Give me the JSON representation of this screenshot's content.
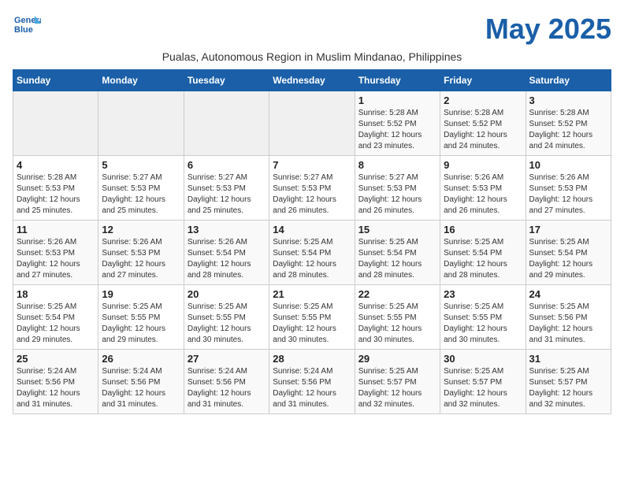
{
  "header": {
    "logo_line1": "General",
    "logo_line2": "Blue",
    "month_title": "May 2025",
    "subtitle": "Pualas, Autonomous Region in Muslim Mindanao, Philippines"
  },
  "weekdays": [
    "Sunday",
    "Monday",
    "Tuesday",
    "Wednesday",
    "Thursday",
    "Friday",
    "Saturday"
  ],
  "weeks": [
    [
      {
        "day": "",
        "info": ""
      },
      {
        "day": "",
        "info": ""
      },
      {
        "day": "",
        "info": ""
      },
      {
        "day": "",
        "info": ""
      },
      {
        "day": "1",
        "info": "Sunrise: 5:28 AM\nSunset: 5:52 PM\nDaylight: 12 hours\nand 23 minutes."
      },
      {
        "day": "2",
        "info": "Sunrise: 5:28 AM\nSunset: 5:52 PM\nDaylight: 12 hours\nand 24 minutes."
      },
      {
        "day": "3",
        "info": "Sunrise: 5:28 AM\nSunset: 5:52 PM\nDaylight: 12 hours\nand 24 minutes."
      }
    ],
    [
      {
        "day": "4",
        "info": "Sunrise: 5:28 AM\nSunset: 5:53 PM\nDaylight: 12 hours\nand 25 minutes."
      },
      {
        "day": "5",
        "info": "Sunrise: 5:27 AM\nSunset: 5:53 PM\nDaylight: 12 hours\nand 25 minutes."
      },
      {
        "day": "6",
        "info": "Sunrise: 5:27 AM\nSunset: 5:53 PM\nDaylight: 12 hours\nand 25 minutes."
      },
      {
        "day": "7",
        "info": "Sunrise: 5:27 AM\nSunset: 5:53 PM\nDaylight: 12 hours\nand 26 minutes."
      },
      {
        "day": "8",
        "info": "Sunrise: 5:27 AM\nSunset: 5:53 PM\nDaylight: 12 hours\nand 26 minutes."
      },
      {
        "day": "9",
        "info": "Sunrise: 5:26 AM\nSunset: 5:53 PM\nDaylight: 12 hours\nand 26 minutes."
      },
      {
        "day": "10",
        "info": "Sunrise: 5:26 AM\nSunset: 5:53 PM\nDaylight: 12 hours\nand 27 minutes."
      }
    ],
    [
      {
        "day": "11",
        "info": "Sunrise: 5:26 AM\nSunset: 5:53 PM\nDaylight: 12 hours\nand 27 minutes."
      },
      {
        "day": "12",
        "info": "Sunrise: 5:26 AM\nSunset: 5:53 PM\nDaylight: 12 hours\nand 27 minutes."
      },
      {
        "day": "13",
        "info": "Sunrise: 5:26 AM\nSunset: 5:54 PM\nDaylight: 12 hours\nand 28 minutes."
      },
      {
        "day": "14",
        "info": "Sunrise: 5:25 AM\nSunset: 5:54 PM\nDaylight: 12 hours\nand 28 minutes."
      },
      {
        "day": "15",
        "info": "Sunrise: 5:25 AM\nSunset: 5:54 PM\nDaylight: 12 hours\nand 28 minutes."
      },
      {
        "day": "16",
        "info": "Sunrise: 5:25 AM\nSunset: 5:54 PM\nDaylight: 12 hours\nand 28 minutes."
      },
      {
        "day": "17",
        "info": "Sunrise: 5:25 AM\nSunset: 5:54 PM\nDaylight: 12 hours\nand 29 minutes."
      }
    ],
    [
      {
        "day": "18",
        "info": "Sunrise: 5:25 AM\nSunset: 5:54 PM\nDaylight: 12 hours\nand 29 minutes."
      },
      {
        "day": "19",
        "info": "Sunrise: 5:25 AM\nSunset: 5:55 PM\nDaylight: 12 hours\nand 29 minutes."
      },
      {
        "day": "20",
        "info": "Sunrise: 5:25 AM\nSunset: 5:55 PM\nDaylight: 12 hours\nand 30 minutes."
      },
      {
        "day": "21",
        "info": "Sunrise: 5:25 AM\nSunset: 5:55 PM\nDaylight: 12 hours\nand 30 minutes."
      },
      {
        "day": "22",
        "info": "Sunrise: 5:25 AM\nSunset: 5:55 PM\nDaylight: 12 hours\nand 30 minutes."
      },
      {
        "day": "23",
        "info": "Sunrise: 5:25 AM\nSunset: 5:55 PM\nDaylight: 12 hours\nand 30 minutes."
      },
      {
        "day": "24",
        "info": "Sunrise: 5:25 AM\nSunset: 5:56 PM\nDaylight: 12 hours\nand 31 minutes."
      }
    ],
    [
      {
        "day": "25",
        "info": "Sunrise: 5:24 AM\nSunset: 5:56 PM\nDaylight: 12 hours\nand 31 minutes."
      },
      {
        "day": "26",
        "info": "Sunrise: 5:24 AM\nSunset: 5:56 PM\nDaylight: 12 hours\nand 31 minutes."
      },
      {
        "day": "27",
        "info": "Sunrise: 5:24 AM\nSunset: 5:56 PM\nDaylight: 12 hours\nand 31 minutes."
      },
      {
        "day": "28",
        "info": "Sunrise: 5:24 AM\nSunset: 5:56 PM\nDaylight: 12 hours\nand 31 minutes."
      },
      {
        "day": "29",
        "info": "Sunrise: 5:25 AM\nSunset: 5:57 PM\nDaylight: 12 hours\nand 32 minutes."
      },
      {
        "day": "30",
        "info": "Sunrise: 5:25 AM\nSunset: 5:57 PM\nDaylight: 12 hours\nand 32 minutes."
      },
      {
        "day": "31",
        "info": "Sunrise: 5:25 AM\nSunset: 5:57 PM\nDaylight: 12 hours\nand 32 minutes."
      }
    ]
  ]
}
